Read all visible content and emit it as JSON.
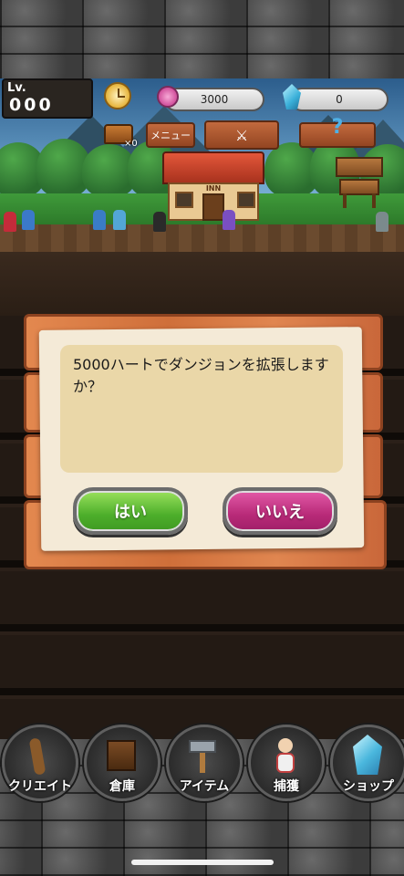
{
  "hud": {
    "level_label": "Lv.",
    "level_value": "000",
    "hearts": "3000",
    "crystals": "0",
    "chest_count": "×0",
    "menu_label": "メニュー",
    "inn_sign": "INN"
  },
  "dialog": {
    "message": "5000ハートでダンジョンを拡張しますか？",
    "yes_label": "はい",
    "no_label": "いいえ"
  },
  "bottom_nav": [
    {
      "label": "クリエイト",
      "icon": "staff-icon"
    },
    {
      "label": "倉庫",
      "icon": "cabinet-icon"
    },
    {
      "label": "アイテム",
      "icon": "hammer-icon"
    },
    {
      "label": "捕獲",
      "icon": "doll-icon"
    },
    {
      "label": "ショップ",
      "icon": "crystal-icon"
    }
  ],
  "colors": {
    "yes_button": "#4dae2b",
    "no_button": "#b82a78",
    "plank": "#cf6f3a"
  }
}
